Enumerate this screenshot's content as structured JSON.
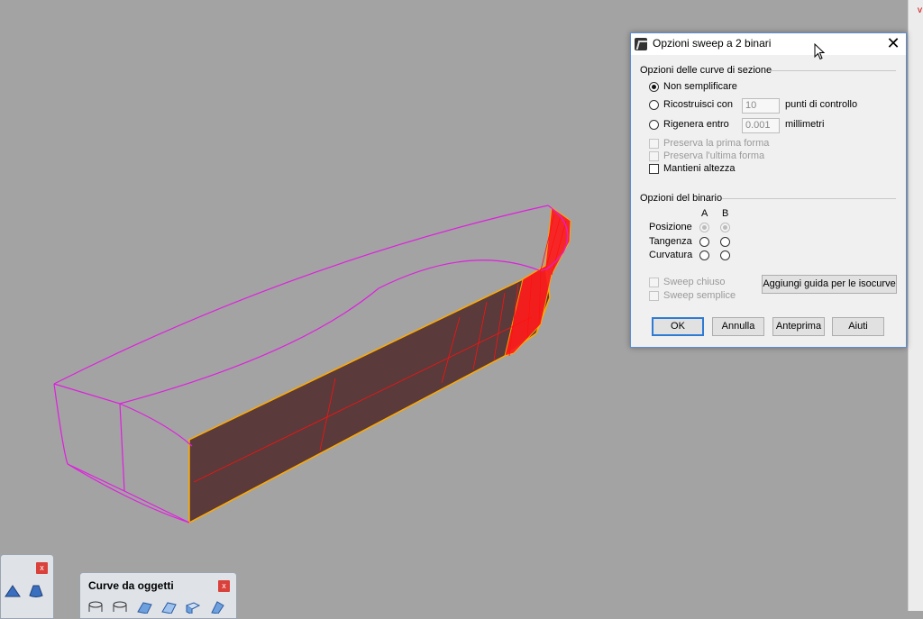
{
  "dialog": {
    "title": "Opzioni sweep a 2 binari",
    "section_curves": {
      "header": "Opzioni delle curve di sezione",
      "opt_no_simplify": "Non semplificare",
      "opt_rebuild": "Ricostruisci con",
      "rebuild_value": "10",
      "rebuild_unit": "punti di controllo",
      "opt_refit": "Rigenera entro",
      "refit_value": "0.001",
      "refit_unit": "millimetri",
      "chk_preserve_first": "Preserva la prima forma",
      "chk_preserve_last": "Preserva l'ultima forma",
      "chk_keep_height": "Mantieni altezza"
    },
    "section_rail": {
      "header": "Opzioni del binario",
      "col_a": "A",
      "col_b": "B",
      "row_position": "Posizione",
      "row_tangency": "Tangenza",
      "row_curvature": "Curvatura"
    },
    "chk_closed_sweep": "Sweep chiuso",
    "chk_simple_sweep": "Sweep semplice",
    "btn_add_guide": "Aggiungi guida per le isocurve",
    "btn_ok": "OK",
    "btn_cancel": "Annulla",
    "btn_preview": "Anteprima",
    "btn_help": "Aiuti"
  },
  "toolbars": {
    "curve_from_objects": "Curve da oggetti",
    "close_glyph": "x"
  },
  "colors": {
    "viewport": "#a3a3a3",
    "curve": "#e01ee0",
    "surface": "#5a3a3a",
    "highlight": "#ffaa00",
    "isocurve": "#ff1010"
  }
}
